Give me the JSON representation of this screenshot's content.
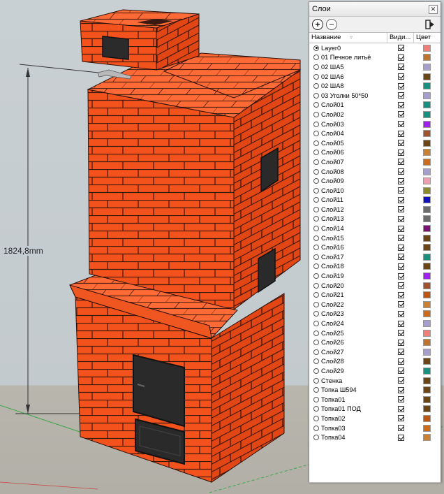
{
  "dimension_label": "1824,8mm",
  "panel": {
    "title": "Слои",
    "close_label": "✕",
    "add_icon": "plus-circle-icon",
    "remove_icon": "minus-circle-icon",
    "details_icon": "details-arrow-icon",
    "columns": {
      "name": "Название",
      "visible": "Види...",
      "color": "Цвет"
    }
  },
  "layers": [
    {
      "name": "Layer0",
      "active": true,
      "visible": true,
      "color": "#f07d78"
    },
    {
      "name": "01 Печное литьё",
      "active": false,
      "visible": true,
      "color": "#c0762a"
    },
    {
      "name": "02 ША5",
      "active": false,
      "visible": true,
      "color": "#a59fd0"
    },
    {
      "name": "02 ША6",
      "active": false,
      "visible": true,
      "color": "#6b4513"
    },
    {
      "name": "02 ША8",
      "active": false,
      "visible": true,
      "color": "#179080"
    },
    {
      "name": "03 Уголки 50*50",
      "active": false,
      "visible": true,
      "color": "#a59fd0"
    },
    {
      "name": "Слой01",
      "active": false,
      "visible": true,
      "color": "#179080"
    },
    {
      "name": "Слой02",
      "active": false,
      "visible": true,
      "color": "#179080"
    },
    {
      "name": "Слой03",
      "active": false,
      "visible": true,
      "color": "#a020f0"
    },
    {
      "name": "Слой04",
      "active": false,
      "visible": true,
      "color": "#a0522d"
    },
    {
      "name": "Слой05",
      "active": false,
      "visible": true,
      "color": "#6b4513"
    },
    {
      "name": "Слой06",
      "active": false,
      "visible": true,
      "color": "#cd7f32"
    },
    {
      "name": "Слой07",
      "active": false,
      "visible": true,
      "color": "#cd6b1a"
    },
    {
      "name": "Слой08",
      "active": false,
      "visible": true,
      "color": "#a59fd0"
    },
    {
      "name": "Слой09",
      "active": false,
      "visible": true,
      "color": "#f29cb0"
    },
    {
      "name": "Слой10",
      "active": false,
      "visible": true,
      "color": "#8b8b2a"
    },
    {
      "name": "Слой11",
      "active": false,
      "visible": true,
      "color": "#1010c0"
    },
    {
      "name": "Слой12",
      "active": false,
      "visible": true,
      "color": "#6b6b6b"
    },
    {
      "name": "Слой13",
      "active": false,
      "visible": true,
      "color": "#6b6b6b"
    },
    {
      "name": "Слой14",
      "active": false,
      "visible": true,
      "color": "#7a1070"
    },
    {
      "name": "Слой15",
      "active": false,
      "visible": true,
      "color": "#6b4513"
    },
    {
      "name": "Слой16",
      "active": false,
      "visible": true,
      "color": "#6b4513"
    },
    {
      "name": "Слой17",
      "active": false,
      "visible": true,
      "color": "#179080"
    },
    {
      "name": "Слой18",
      "active": false,
      "visible": true,
      "color": "#6b4513"
    },
    {
      "name": "Слой19",
      "active": false,
      "visible": true,
      "color": "#a020f0"
    },
    {
      "name": "Слой20",
      "active": false,
      "visible": true,
      "color": "#a0522d"
    },
    {
      "name": "Слой21",
      "active": false,
      "visible": true,
      "color": "#c05510"
    },
    {
      "name": "Слой22",
      "active": false,
      "visible": true,
      "color": "#cd7f32"
    },
    {
      "name": "Слой23",
      "active": false,
      "visible": true,
      "color": "#cd6b1a"
    },
    {
      "name": "Слой24",
      "active": false,
      "visible": true,
      "color": "#a59fd0"
    },
    {
      "name": "Слой25",
      "active": false,
      "visible": true,
      "color": "#f07d78"
    },
    {
      "name": "Слой26",
      "active": false,
      "visible": true,
      "color": "#c0762a"
    },
    {
      "name": "Слой27",
      "active": false,
      "visible": true,
      "color": "#a59fd0"
    },
    {
      "name": "Слой28",
      "active": false,
      "visible": true,
      "color": "#6b4513"
    },
    {
      "name": "Слой29",
      "active": false,
      "visible": true,
      "color": "#179080"
    },
    {
      "name": "Стенка",
      "active": false,
      "visible": true,
      "color": "#6b4513"
    },
    {
      "name": "Топка Ш594",
      "active": false,
      "visible": true,
      "color": "#6b4513"
    },
    {
      "name": "Топка01",
      "active": false,
      "visible": true,
      "color": "#6b4513"
    },
    {
      "name": "Топка01 ПОД",
      "active": false,
      "visible": true,
      "color": "#6b4513"
    },
    {
      "name": "Топка02",
      "active": false,
      "visible": true,
      "color": "#c05510"
    },
    {
      "name": "Топка03",
      "active": false,
      "visible": true,
      "color": "#cd6b1a"
    },
    {
      "name": "Топка04",
      "active": false,
      "visible": true,
      "color": "#cd7f32"
    }
  ]
}
